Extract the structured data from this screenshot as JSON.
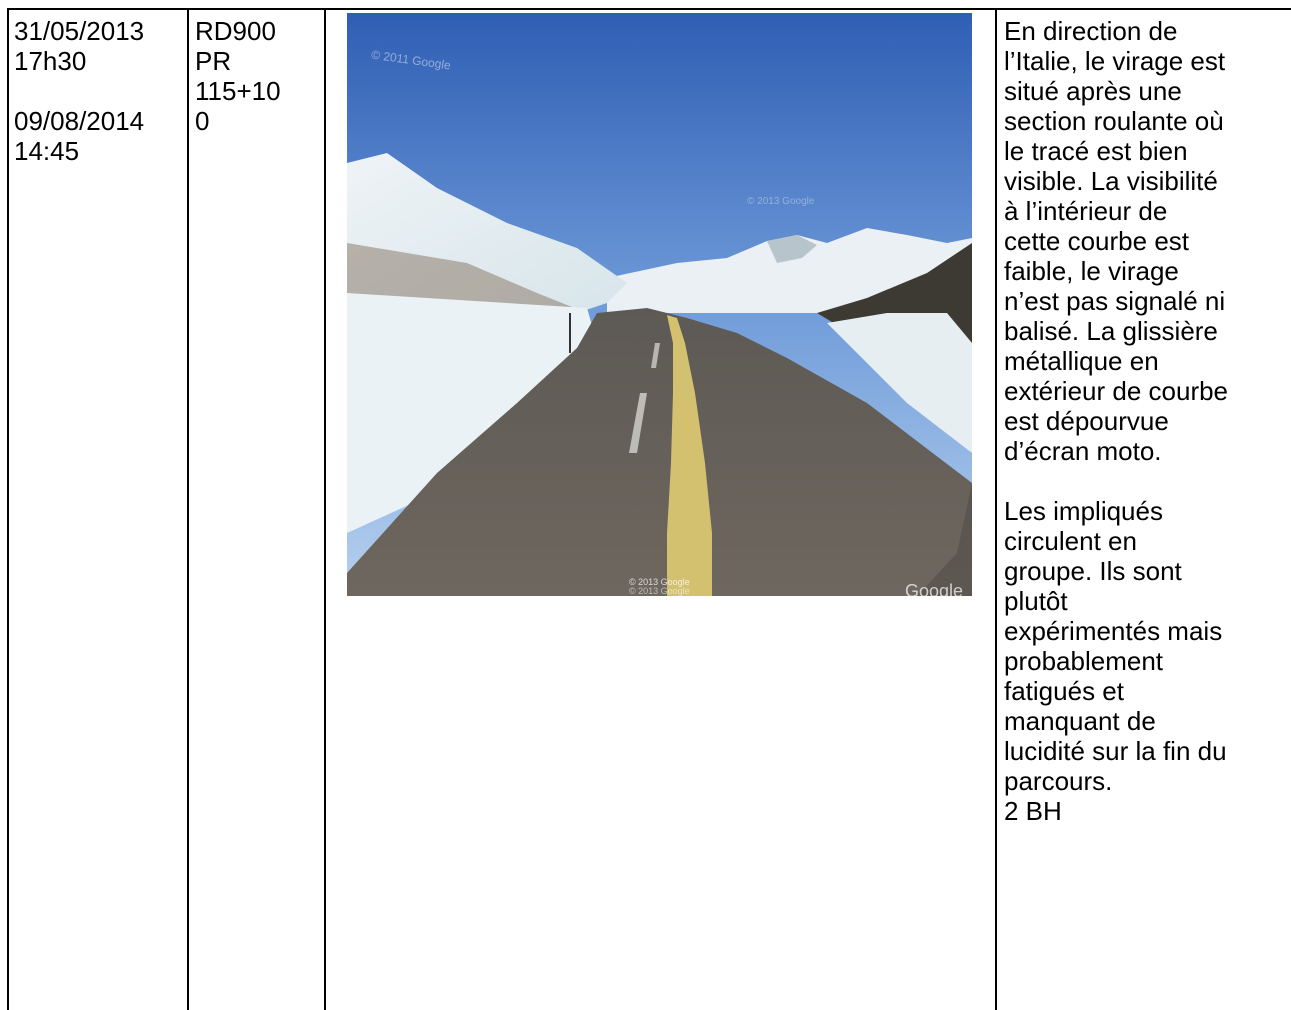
{
  "row": {
    "col1": {
      "date1": "31/05/2013",
      "time1": "17h30",
      "date2": "09/08/2014",
      "time2": "14:45"
    },
    "col2": {
      "road": "RD900",
      "pr": "PR",
      "pr_value_line1": "115+10",
      "pr_value_line2": "0"
    },
    "photo": {
      "watermark_top": "© 2011 Google",
      "watermark_mid": "© 2013 Google",
      "watermark_bottom_1": "© 2013 Google",
      "watermark_bottom_2": "© 2013 Google",
      "logo": "Google"
    },
    "col4": {
      "p1": [
        "En direction de",
        "l’Italie, le virage est",
        "situé après une",
        "section roulante où",
        "le tracé est bien",
        "visible. La visibilité",
        "à l’intérieur de",
        "cette courbe est",
        "faible, le virage",
        "n’est pas signalé ni",
        "balisé. La glissière",
        "métallique en",
        "extérieur de courbe",
        "est dépourvue",
        "d’écran moto."
      ],
      "p2": [
        "Les impliqués",
        "circulent en",
        "groupe. Ils sont",
        "plutôt",
        "expérimentés mais",
        "probablement",
        "fatigués et",
        "manquant de",
        "lucidité sur la fin du",
        "parcours."
      ],
      "tail": "2 BH"
    }
  }
}
